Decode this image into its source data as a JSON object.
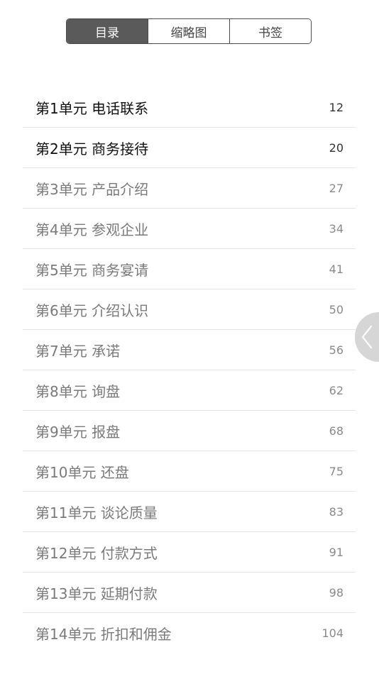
{
  "tabs": [
    {
      "label": "目录",
      "active": true
    },
    {
      "label": "缩略图",
      "active": false
    },
    {
      "label": "书签",
      "active": false
    }
  ],
  "toc": [
    {
      "title": "第1单元 电话联系",
      "page": "12",
      "read": true
    },
    {
      "title": "第2单元 商务接待",
      "page": "20",
      "read": true
    },
    {
      "title": "第3单元 产品介绍",
      "page": "27",
      "read": false
    },
    {
      "title": "第4单元 参观企业",
      "page": "34",
      "read": false
    },
    {
      "title": "第5单元 商务宴请",
      "page": "41",
      "read": false
    },
    {
      "title": "第6单元 介绍认识",
      "page": "50",
      "read": false
    },
    {
      "title": "第7单元 承诺",
      "page": "56",
      "read": false
    },
    {
      "title": "第8单元 询盘",
      "page": "62",
      "read": false
    },
    {
      "title": "第9单元 报盘",
      "page": "68",
      "read": false
    },
    {
      "title": "第10单元 还盘",
      "page": "75",
      "read": false
    },
    {
      "title": "第11单元 谈论质量",
      "page": "83",
      "read": false
    },
    {
      "title": "第12单元 付款方式",
      "page": "91",
      "read": false
    },
    {
      "title": "第13单元 延期付款",
      "page": "98",
      "read": false
    },
    {
      "title": "第14单元 折扣和佣金",
      "page": "104",
      "read": false
    }
  ],
  "side_tab": {
    "icon": "chevron-left-icon"
  },
  "colors": {
    "active_tab_bg": "#5a5a5a",
    "read_text": "#111111",
    "unread_text": "#7a7a7a",
    "divider": "#e4e4e4"
  }
}
